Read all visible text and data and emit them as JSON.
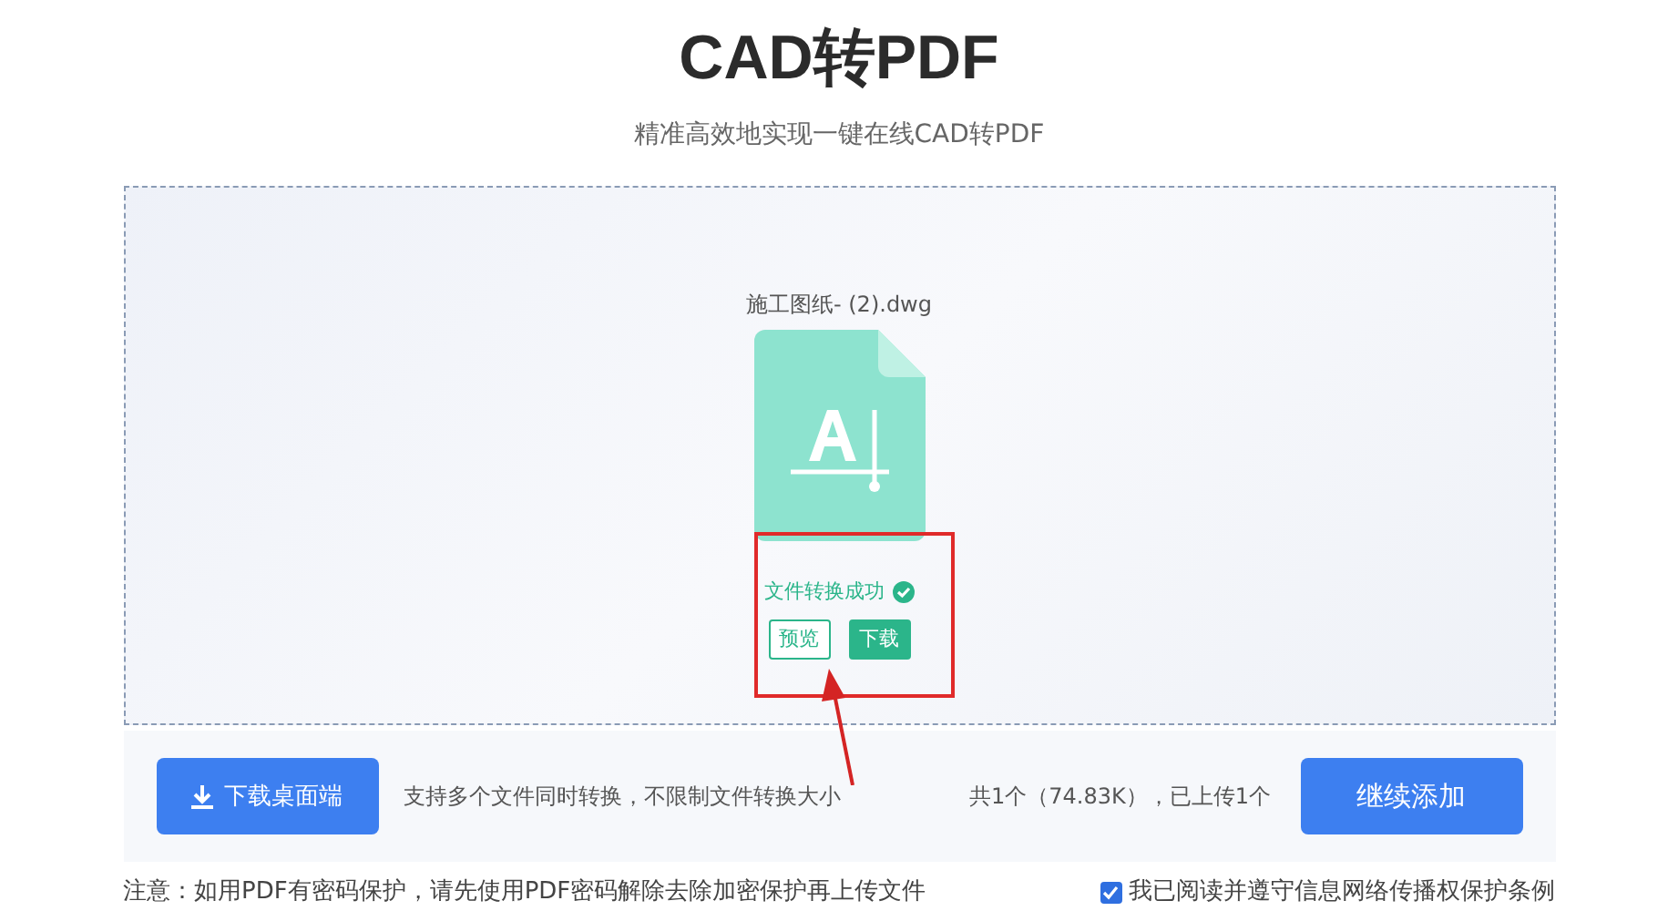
{
  "title": "CAD转PDF",
  "subtitle": "精准高效地实现一键在线CAD转PDF",
  "file": {
    "name": "施工图纸- (2).dwg",
    "status": "文件转换成功",
    "converted": true,
    "actions": [
      {
        "label": "预览",
        "kind": "outline"
      },
      {
        "label": "下载",
        "kind": "solid"
      }
    ]
  },
  "bar": {
    "desktop_button": "下载桌面端",
    "hint": "支持多个文件同时转换，不限制文件转换大小",
    "summary": "共1个（74.83K），已上传1个",
    "add_button": "继续添加"
  },
  "notice": "注意：如用PDF有密码保护，请先使用PDF密码解除去除加密保护再上传文件",
  "agreement": {
    "label": "我已阅读并遵守信息网络传播权保护条例",
    "checked": true
  }
}
